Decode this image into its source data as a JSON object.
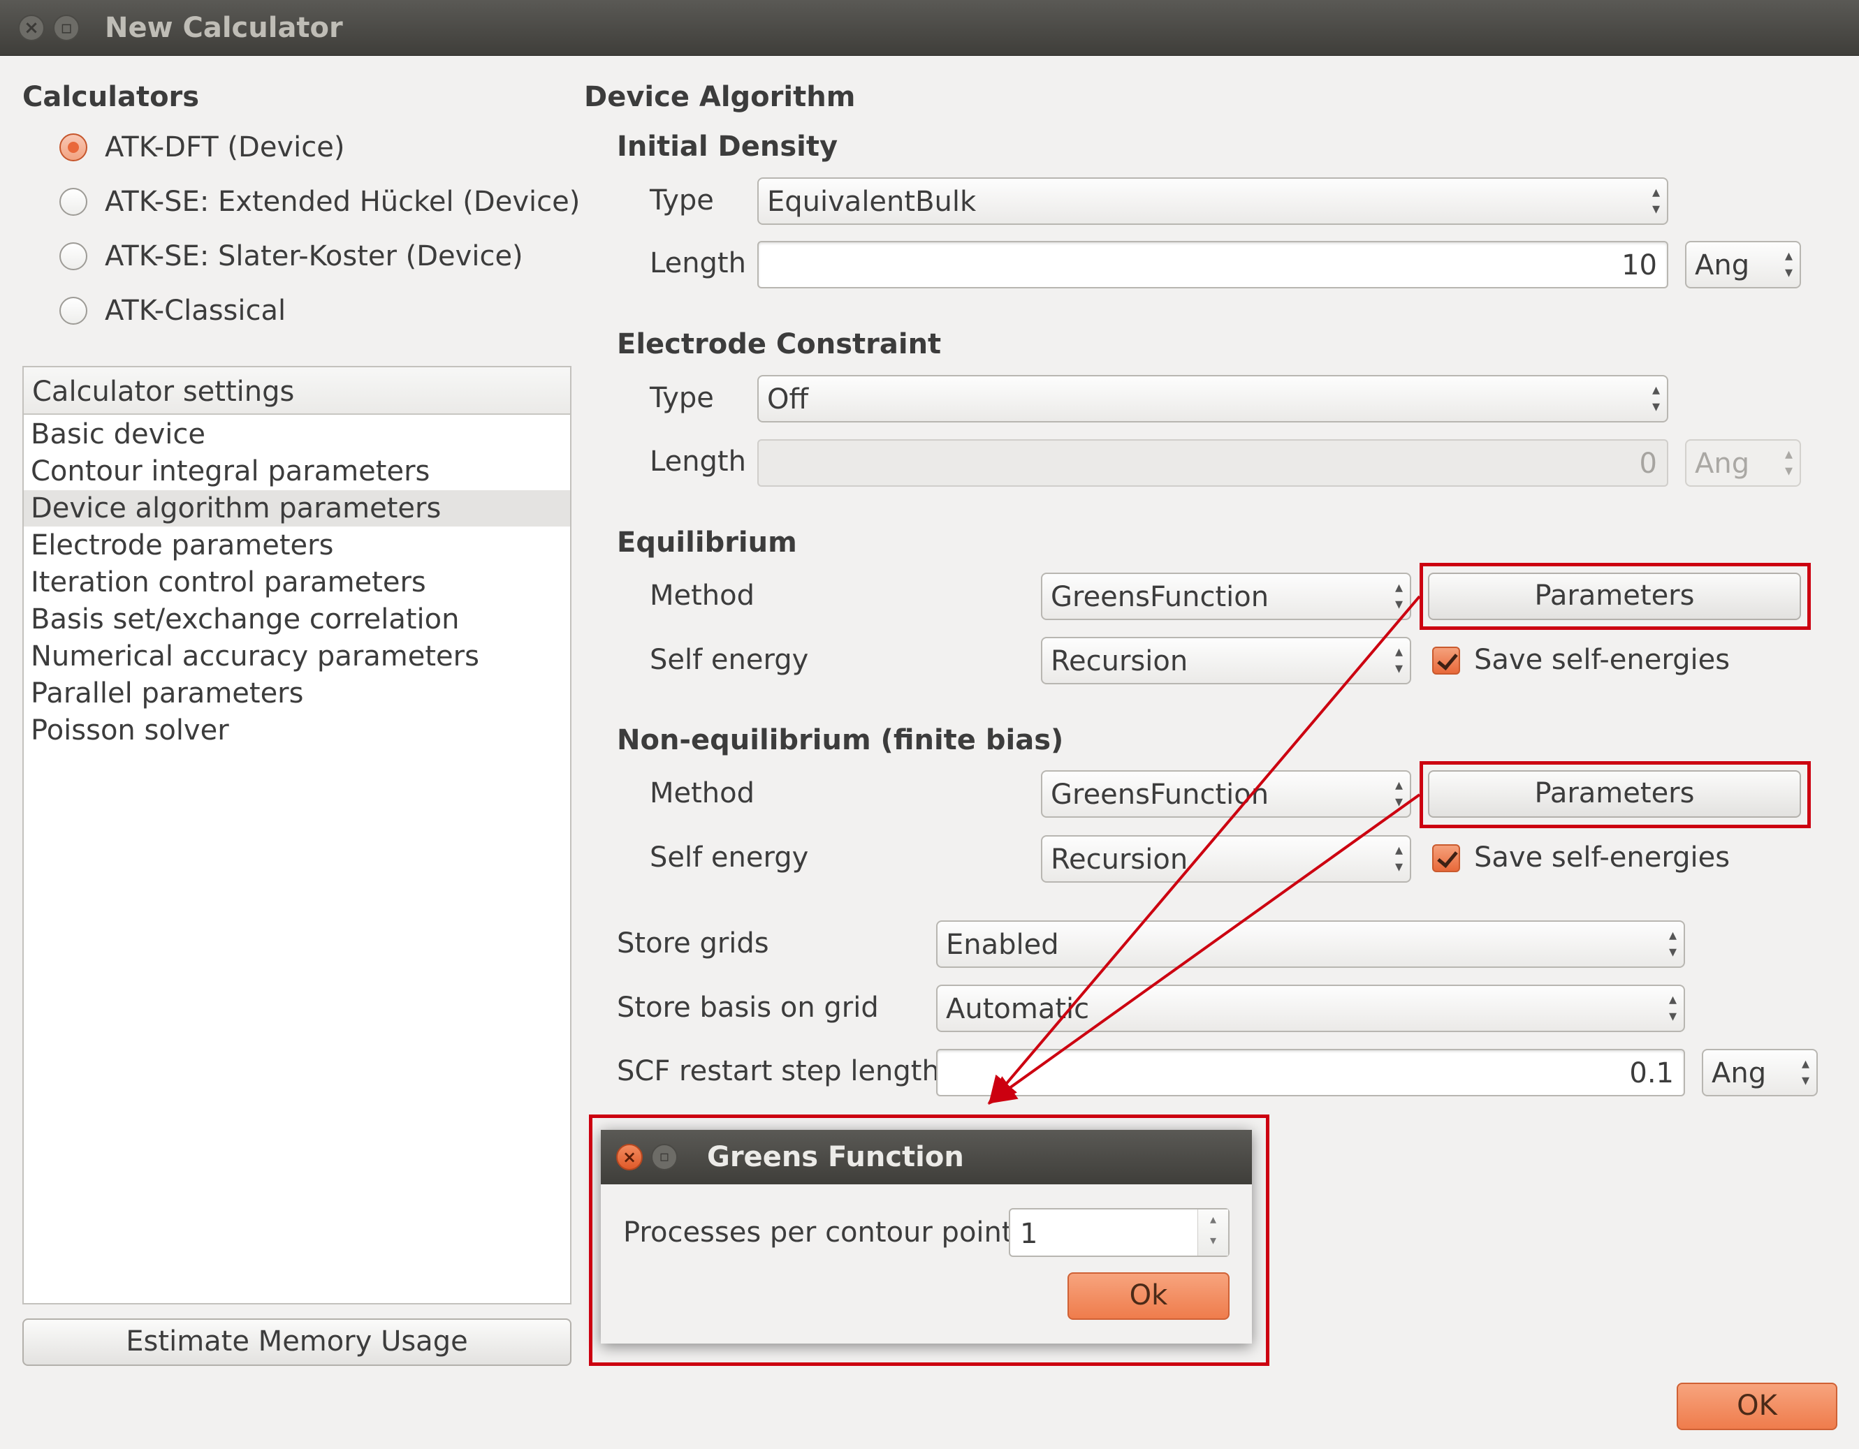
{
  "window": {
    "title": "New Calculator"
  },
  "calculators": {
    "heading": "Calculators",
    "options": [
      {
        "label": "ATK-DFT (Device)",
        "selected": true
      },
      {
        "label": "ATK-SE: Extended Hückel (Device)",
        "selected": false
      },
      {
        "label": "ATK-SE: Slater-Koster (Device)",
        "selected": false
      },
      {
        "label": "ATK-Classical",
        "selected": false
      }
    ]
  },
  "settings": {
    "header": "Calculator settings",
    "items": [
      "Basic device",
      "Contour integral parameters",
      "Device algorithm parameters",
      "Electrode parameters",
      "Iteration control parameters",
      "Basis set/exchange correlation",
      "Numerical accuracy parameters",
      "Parallel parameters",
      "Poisson solver"
    ],
    "selected_index": 2
  },
  "estimate_button": "Estimate Memory Usage",
  "device_algorithm": {
    "heading": "Device Algorithm",
    "initial_density": {
      "heading": "Initial Density",
      "type_label": "Type",
      "type_value": "EquivalentBulk",
      "length_label": "Length",
      "length_value": "10",
      "length_unit": "Ang"
    },
    "electrode_constraint": {
      "heading": "Electrode Constraint",
      "type_label": "Type",
      "type_value": "Off",
      "length_label": "Length",
      "length_value": "0",
      "length_unit": "Ang"
    },
    "equilibrium": {
      "heading": "Equilibrium",
      "method_label": "Method",
      "method_value": "GreensFunction",
      "parameters_button": "Parameters",
      "self_energy_label": "Self energy",
      "self_energy_value": "Recursion",
      "save_label": "Save self-energies",
      "save_checked": true
    },
    "non_equilibrium": {
      "heading": "Non-equilibrium (finite bias)",
      "method_label": "Method",
      "method_value": "GreensFunction",
      "parameters_button": "Parameters",
      "self_energy_label": "Self energy",
      "self_energy_value": "Recursion",
      "save_label": "Save self-energies",
      "save_checked": true
    },
    "store_grids_label": "Store grids",
    "store_grids_value": "Enabled",
    "store_basis_label": "Store basis on grid",
    "store_basis_value": "Automatic",
    "scf_label": "SCF restart step length",
    "scf_value": "0.1",
    "scf_unit": "Ang"
  },
  "ok_button": "OK",
  "dialog": {
    "title": "Greens Function",
    "field_label": "Processes per contour point",
    "field_value": "1",
    "ok_button": "Ok"
  },
  "annotation_color": "#cc0010",
  "accent_color": "#e9683a"
}
